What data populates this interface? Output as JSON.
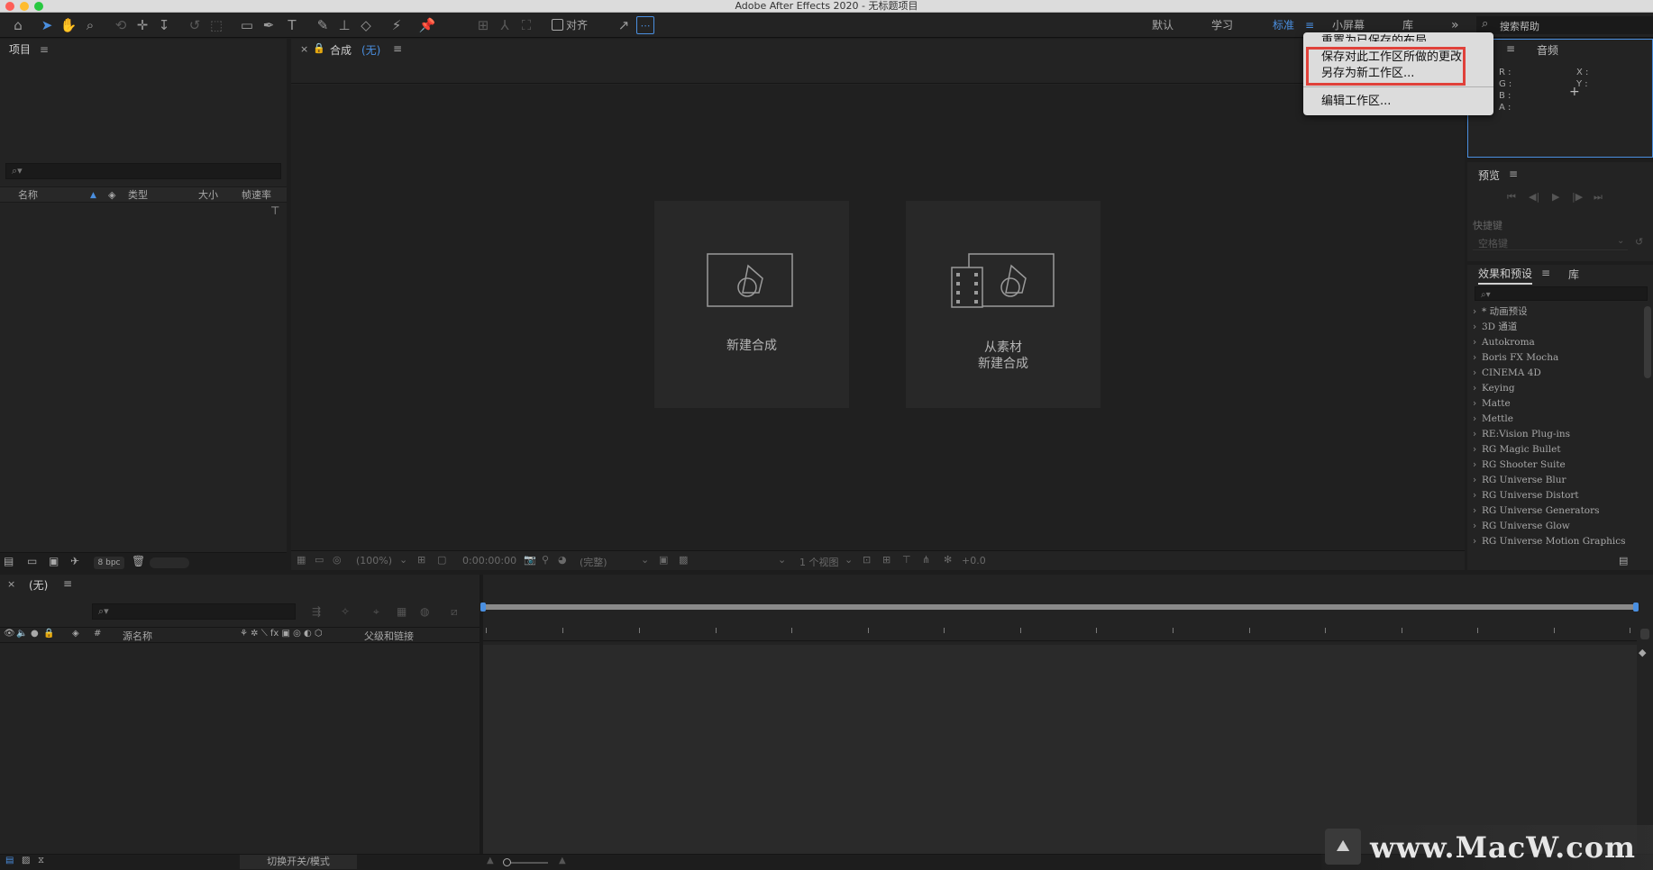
{
  "app": {
    "window_title": "Adobe After Effects 2020 - 无标题项目"
  },
  "toolbar": {
    "tools": [
      "home-icon",
      "selection-tool-icon",
      "hand-tool-icon",
      "zoom-tool-icon",
      "orbit-camera-icon",
      "pan-camera-icon",
      "dolly-camera-icon",
      "rotation-tool-icon",
      "anchor-point-tool-icon",
      "rectangle-tool-icon",
      "pen-tool-icon",
      "type-tool-icon",
      "brush-tool-icon",
      "clone-stamp-icon",
      "eraser-icon",
      "roto-brush-icon",
      "puppet-pin-icon"
    ],
    "align_label": "对齐"
  },
  "workspaces": {
    "tabs": [
      "默认",
      "学习",
      "标准",
      "小屏幕",
      "库"
    ],
    "active": "标准",
    "more_label": "»",
    "search_placeholder": "搜索帮助"
  },
  "workspace_menu": {
    "items": [
      "重置为已保存的布局",
      "保存对此工作区所做的更改",
      "另存为新工作区...",
      "编辑工作区..."
    ]
  },
  "project_panel": {
    "title": "项目",
    "columns": [
      "名称",
      "类型",
      "大小",
      "帧速率"
    ],
    "bpc_label": "8 bpc"
  },
  "composition_panel": {
    "title": "合成",
    "comp_name": "(无)",
    "new_comp_label": "新建合成",
    "from_footage_line1": "从素材",
    "from_footage_line2": "新建合成",
    "zoom_value": "(100%)",
    "timecode": "0:00:00:00",
    "resolution": "(完整)",
    "views": "1 个视图",
    "exposure": "+0.0"
  },
  "info_panel": {
    "audio_tab": "音频",
    "r_label": "R :",
    "g_label": "G :",
    "b_label": "B :",
    "a_label": "A :",
    "x_label": "X :",
    "y_label": "Y :"
  },
  "preview_panel": {
    "title": "预览",
    "shortcut_label": "快捷键",
    "shortcut_value": "空格键"
  },
  "effects_panel": {
    "title": "效果和预设",
    "library_tab": "库",
    "items": [
      "* 动画预设",
      "3D 通道",
      "Autokroma",
      "Boris FX Mocha",
      "CINEMA 4D",
      "Keying",
      "Matte",
      "Mettle",
      "RE:Vision Plug-ins",
      "RG Magic Bullet",
      "RG Shooter Suite",
      "RG Universe Blur",
      "RG Universe Distort",
      "RG Universe Generators",
      "RG Universe Glow",
      "RG Universe Motion Graphics"
    ]
  },
  "timeline": {
    "comp_name": "(无)",
    "source_name_col": "源名称",
    "parent_col": "父级和链接",
    "toggle_label": "切换开关/模式"
  },
  "watermark": "www.MacW.com",
  "colors": {
    "accent": "#4a8fe0",
    "highlight_box": "#e0413a",
    "panel_bg": "#232323"
  }
}
